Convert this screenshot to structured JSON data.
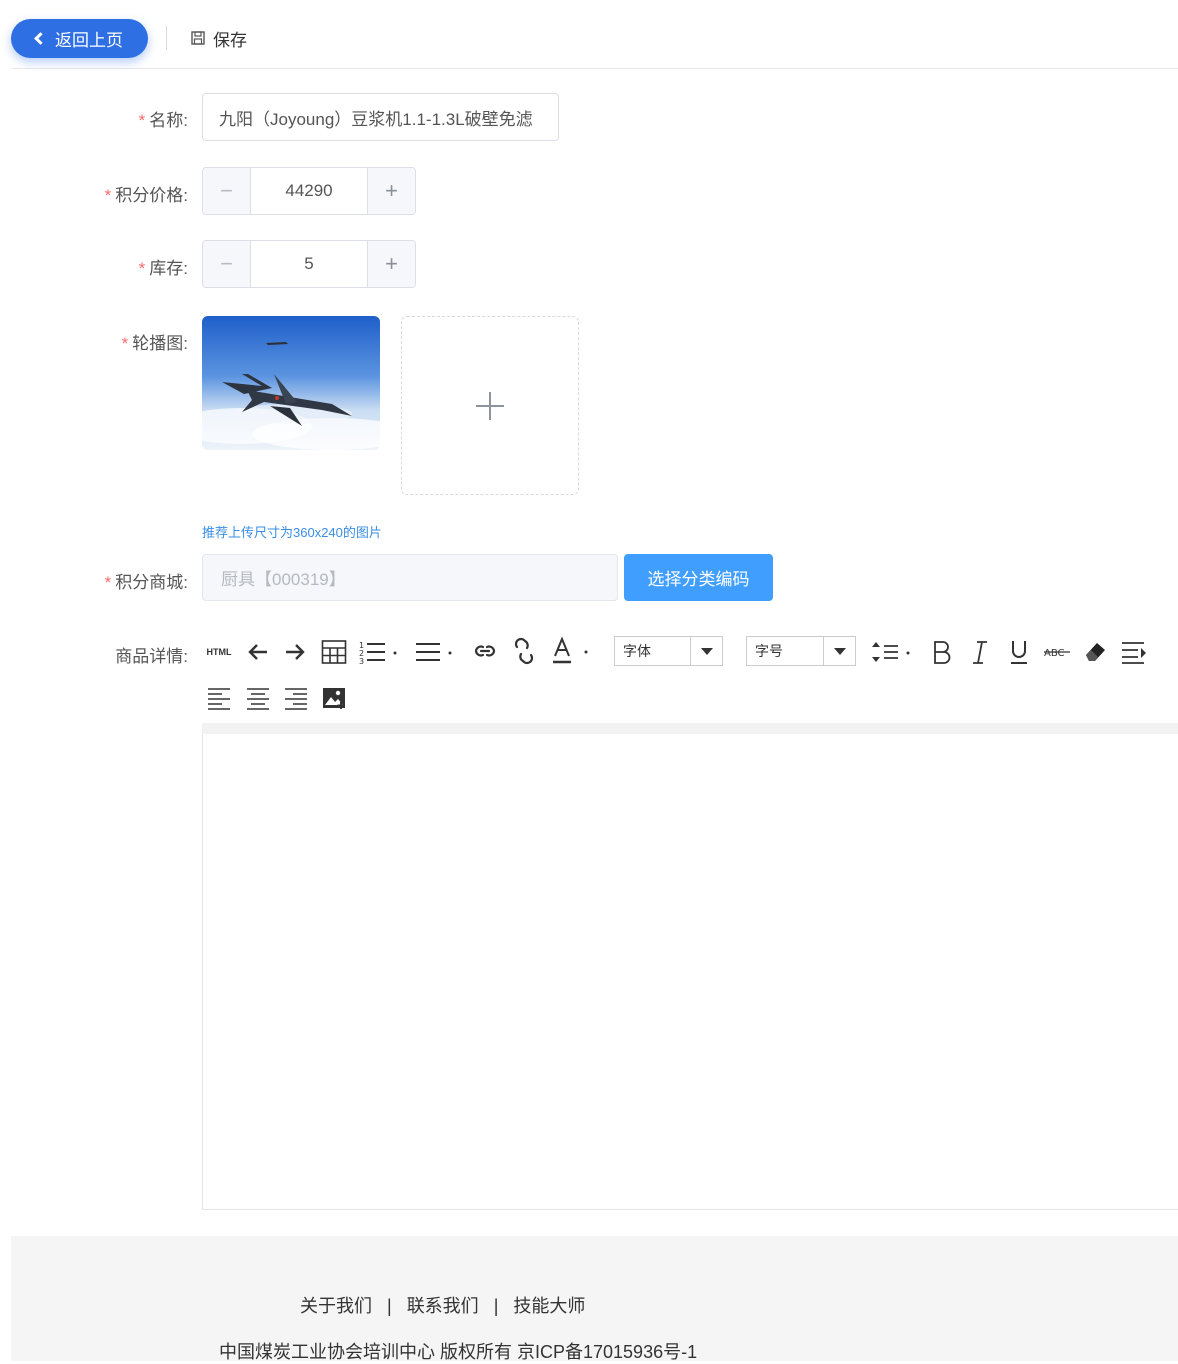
{
  "header": {
    "back_label": "返回上页",
    "save_label": "保存"
  },
  "form": {
    "name": {
      "label": "名称:",
      "required_mark": "*",
      "value": "九阳（Joyoung）豆浆机1.1-1.3L破壁免滤"
    },
    "points_price": {
      "label": "积分价格:",
      "required_mark": "*",
      "value": "44290",
      "minus": "−",
      "plus": "+"
    },
    "stock": {
      "label": "库存:",
      "required_mark": "*",
      "value": "5",
      "minus": "−",
      "plus": "+"
    },
    "carousel": {
      "label": "轮播图:",
      "required_mark": "*",
      "hint": "推荐上传尺寸为360x240的图片"
    },
    "mall": {
      "label": "积分商城:",
      "required_mark": "*",
      "placeholder": "厨具【000319】",
      "select_button": "选择分类编码"
    },
    "details": {
      "label": "商品详情:"
    }
  },
  "editor_toolbar": {
    "html_label": "HTML",
    "font_family": "字体",
    "font_size": "字号",
    "icons": [
      "html-icon",
      "undo-icon",
      "redo-icon",
      "table-icon",
      "ordered-list-icon",
      "unordered-list-icon",
      "link-icon",
      "unlink-icon",
      "font-color-icon",
      "line-height-icon",
      "bold-icon",
      "italic-icon",
      "underline-icon",
      "strikethrough-icon",
      "eraser-icon",
      "indent-icon",
      "align-left-icon",
      "align-center-icon",
      "align-right-icon",
      "insert-image-icon"
    ]
  },
  "footer": {
    "links": [
      "关于我们",
      "联系我们",
      "技能大师"
    ],
    "separator": "|",
    "copyright": "中国煤炭工业协会培训中心 版权所有 京ICP备17015936号-1"
  },
  "colors": {
    "primary": "#2f6fe4",
    "button_blue": "#409eff",
    "required": "#f56c6c",
    "hint": "#3a8ee6"
  }
}
